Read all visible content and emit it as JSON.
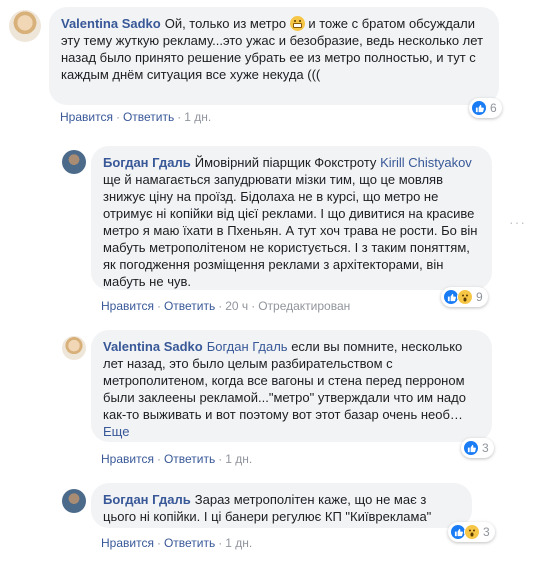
{
  "comments": [
    {
      "author": "Valentina Sadko",
      "text_before_emoji": "Ой, только из метро",
      "text_after_emoji": " и тоже с братом обсуждали эту тему жуткую рекламу...это ужас и безобразие, ведь несколько лет назад было принято решение убрать ее из метро полностью, и тут с каждым днём ситуация все хуже некуда (((",
      "actions": {
        "like": "Нравится",
        "reply": "Ответить",
        "time": "1 дн."
      },
      "reactions": {
        "types": [
          "like"
        ],
        "count": "6"
      }
    },
    {
      "author": "Богдан Гдаль",
      "text_before_mention": "Ймовірний піарщик Фокстроту ",
      "mention": "Kirill Chistyakov",
      "text_after_mention": " ще й намагається запудрювати мізки тим, що це мовляв знижує ціну на проїзд. Бідолаха не в курсі, що метро не отримує ні копійки від цієї реклами. І що дивитися на красиве метро я маю їхати в Пхеньян. А тут хоч трава не рости. Бо він мабуть метрополітеном не користується. І з таким поняттям, як погодження розміщення реклами з архітекторами, він мабуть не чув.",
      "actions": {
        "like": "Нравится",
        "reply": "Ответить",
        "time": "20 ч",
        "edited": "Отредактирован"
      },
      "reactions": {
        "types": [
          "like",
          "wow"
        ],
        "count": "9"
      }
    },
    {
      "author": "Valentina Sadko",
      "mention": "Богдан Гдаль",
      "text_after_mention": " если вы помните, несколько лет назад, это было целым разбирательством с метрополитеном, когда все вагоны и стена перед перроном были заклеены рекламой...\"метро\" утверждали что им надо как-то выживать и вот поэтому вот этот базар очень необ…",
      "more": "Еще",
      "actions": {
        "like": "Нравится",
        "reply": "Ответить",
        "time": "1 дн."
      },
      "reactions": {
        "types": [
          "like"
        ],
        "count": "3"
      }
    },
    {
      "author": "Богдан Гдаль",
      "text": "Зараз метрополітен каже, що не має з цього ні копійки. І ці банери регулює КП \"Київреклама\"",
      "actions": {
        "like": "Нравится",
        "reply": "Ответить",
        "time": "1 дн."
      },
      "reactions": {
        "types": [
          "like",
          "wow"
        ],
        "count": "3"
      }
    }
  ],
  "menu_icon": "more-horizontal-icon",
  "colors": {
    "link": "#385898",
    "bubble": "#f2f3f5",
    "meta": "#90949c",
    "like": "#1a7cf5",
    "wow": "#f6c646"
  }
}
